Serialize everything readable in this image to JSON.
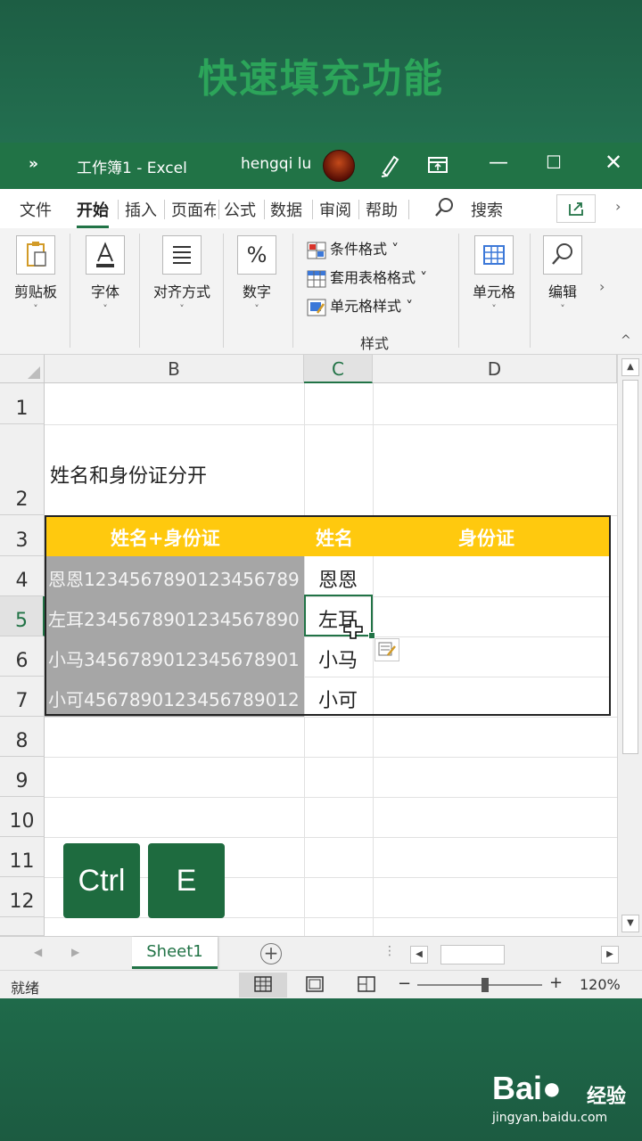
{
  "video_title": "快速填充功能",
  "titlebar": {
    "more": "»",
    "title": "工作簿1  -  Excel",
    "user": "hengqi lu",
    "minimize": "—",
    "maximize": "☐",
    "close": "✕"
  },
  "tabs": [
    "文件",
    "开始",
    "插入",
    "页面布",
    "公式",
    "数据",
    "审阅",
    "帮助"
  ],
  "search_label": "搜索",
  "ribbon": {
    "clipboard": "剪贴板",
    "font": "字体",
    "alignment": "对齐方式",
    "number": "数字",
    "conditional_format": "条件格式 ˅",
    "table_format": "套用表格格式 ˅",
    "cell_style": "单元格样式 ˅",
    "styles_group": "样式",
    "cells": "单元格",
    "editing": "编辑",
    "caret": "˅",
    "more": "›",
    "collapse": "^"
  },
  "grid": {
    "columns": [
      "B",
      "C",
      "D"
    ],
    "rows": [
      "1",
      "2",
      "3",
      "4",
      "5",
      "6",
      "7",
      "8",
      "9",
      "10",
      "11",
      "12"
    ],
    "b2": "姓名和身份证分开",
    "header": {
      "combined": "姓名+身份证",
      "name": "姓名",
      "id": "身份证"
    },
    "data": [
      {
        "combined": "恩恩123456789012345678​9",
        "name": "恩恩"
      },
      {
        "combined": "左耳23456789012345678​90",
        "name": "左耳"
      },
      {
        "combined": "小马3456789012345678​901",
        "name": "小马"
      },
      {
        "combined": "小可456789012345678​9012",
        "name": "小可"
      }
    ]
  },
  "keys": [
    "Ctrl",
    "E"
  ],
  "sheetbar": {
    "sheet": "Sheet1",
    "add": "+",
    "prev": "◀",
    "next": "▶",
    "dots": "⋮"
  },
  "statusbar": {
    "ready": "就绪",
    "minus": "−",
    "plus": "+",
    "zoom": "120%"
  },
  "watermark": {
    "logo": "Bai",
    "logo2": "经验",
    "url": "jingyan.baidu.com"
  },
  "colors": {
    "excel_green": "#217346",
    "header_yellow": "#ffc90e",
    "gray_fill": "#a6a6a6"
  }
}
